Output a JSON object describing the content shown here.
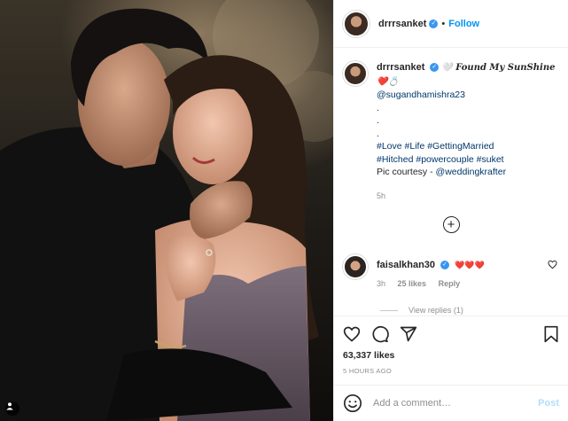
{
  "header": {
    "username": "drrrsanket",
    "dot": "•",
    "follow_label": "Follow"
  },
  "caption": {
    "username": "drrrsanket",
    "title": "🤍 Found My SunShine ❤️💍",
    "mention": "@sugandhamishra23",
    "spacer_lines": [
      ".",
      ".",
      "."
    ],
    "hashtags_line1": "#Love #Life #GettingMarried",
    "hashtags_line2": "#Hitched #powercouple #suket",
    "credit_prefix": "Pic courtesy - ",
    "credit_mention": "@weddingkrafter",
    "time": "5h"
  },
  "load_more_symbol": "+",
  "comment": {
    "username": "faisalkhan30",
    "text": "❤️❤️❤️",
    "time": "3h",
    "likes": "25 likes",
    "reply_label": "Reply",
    "view_replies": "View replies (1)"
  },
  "actions": {
    "icons": [
      "heart-icon",
      "comment-icon",
      "share-icon",
      "bookmark-icon"
    ]
  },
  "likes_count": "63,337 likes",
  "posted_ago": "5 HOURS AGO",
  "add_comment": {
    "placeholder": "Add a comment…",
    "post_label": "Post",
    "icon": "smiley-icon"
  },
  "colors": {
    "link": "#00376b",
    "follow": "#0095f6",
    "verified": "#3897f0",
    "post_disabled": "#b2dffc",
    "muted": "#8e8e8e"
  }
}
